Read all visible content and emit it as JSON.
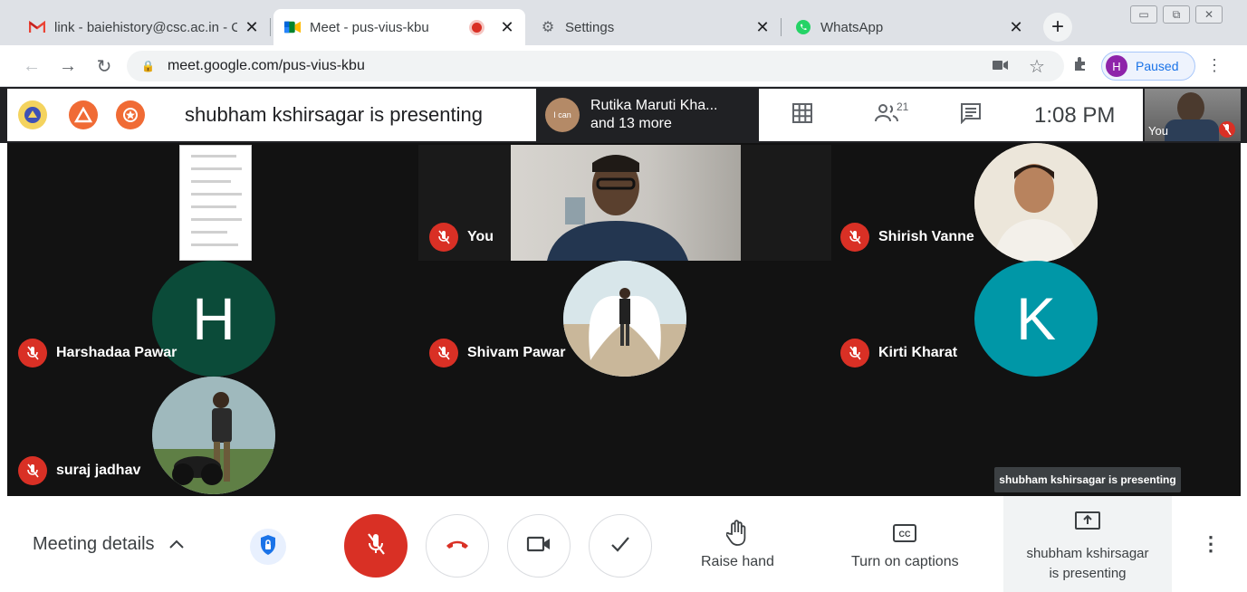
{
  "browser": {
    "tabs": [
      {
        "title": "link - baiehistory@csc.ac.in - C",
        "icon": "gmail-icon"
      },
      {
        "title": "Meet - pus-vius-kbu",
        "icon": "meet-icon",
        "active": true,
        "recording": true
      },
      {
        "title": "Settings",
        "icon": "gear-icon"
      },
      {
        "title": "WhatsApp",
        "icon": "whatsapp-icon"
      }
    ],
    "url": "meet.google.com/pus-vius-kbu",
    "profile": {
      "initial": "H",
      "status": "Paused"
    }
  },
  "meet": {
    "presenting_title": "shubham kshirsagar is presenting",
    "active_speaker": {
      "name": "Rutika Maruti Kha...",
      "more": "and 13 more",
      "badge": "I can"
    },
    "people_count": "21",
    "clock": "1:08 PM",
    "self_label": "You",
    "participants": [
      {
        "name": "You",
        "type": "video"
      },
      {
        "name": "Shirish Vanne",
        "type": "photo"
      },
      {
        "name": "Harshadaa Pawar",
        "type": "letter",
        "letter": "H",
        "color": "#0b4b39"
      },
      {
        "name": "Shivam Pawar",
        "type": "photo"
      },
      {
        "name": "Kirti Kharat",
        "type": "letter",
        "letter": "K",
        "color": "#0097a7"
      },
      {
        "name": "suraj jadhav",
        "type": "photo"
      }
    ],
    "tooltip": "shubham kshirsagar is presenting"
  },
  "controls": {
    "meeting_details": "Meeting details",
    "raise_hand": "Raise hand",
    "captions": "Turn on captions",
    "presenting_line1": "shubham kshirsagar",
    "presenting_line2": "is presenting"
  },
  "colors": {
    "mic_off": "#d93025",
    "accent": "#1a73e8"
  }
}
